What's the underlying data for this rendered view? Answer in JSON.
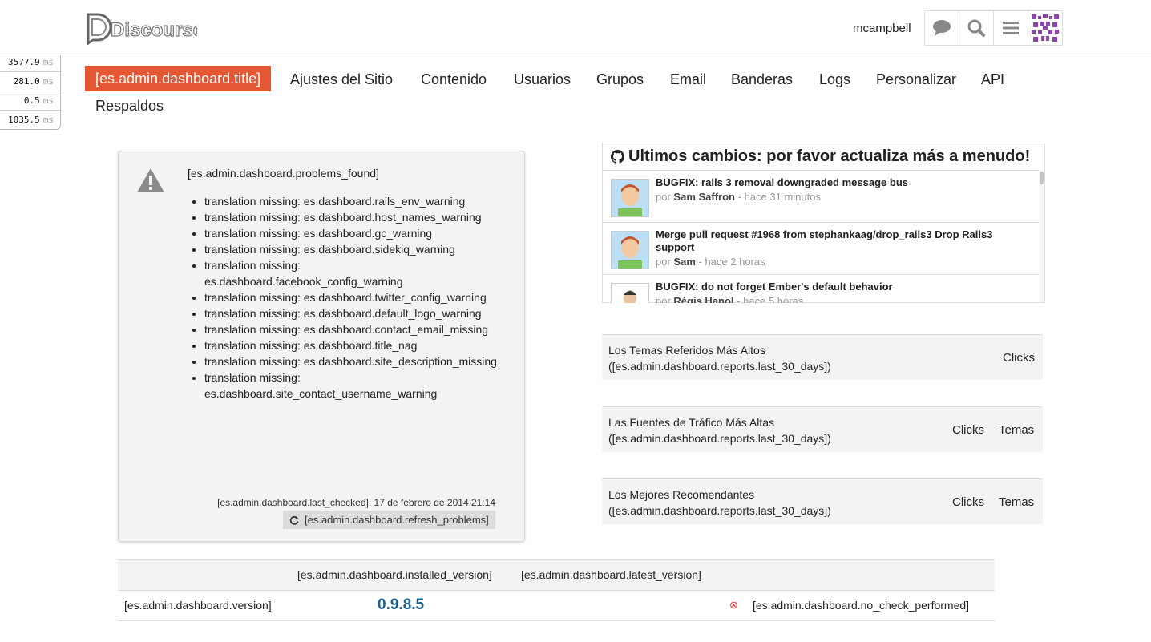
{
  "profiler": [
    {
      "value": "3577.9",
      "unit": "ms"
    },
    {
      "value": "281.0",
      "unit": "ms"
    },
    {
      "value": "0.5",
      "unit": "ms"
    },
    {
      "value": "1035.5",
      "unit": "ms"
    }
  ],
  "header": {
    "logo_text": "Discourse",
    "username": "mcampbell",
    "icons": [
      "chat-bubble-icon",
      "search-icon",
      "hamburger-menu-icon",
      "user-avatar"
    ]
  },
  "nav": {
    "items": [
      {
        "label": "[es.admin.dashboard.title]",
        "active": true
      },
      {
        "label": "Ajustes del Sitio"
      },
      {
        "label": "Contenido"
      },
      {
        "label": "Usuarios"
      },
      {
        "label": "Grupos"
      },
      {
        "label": "Email"
      },
      {
        "label": "Banderas"
      },
      {
        "label": "Logs"
      },
      {
        "label": "Personalizar"
      },
      {
        "label": "API"
      },
      {
        "label": "Respaldos"
      }
    ]
  },
  "problems": {
    "title": "[es.admin.dashboard.problems_found]",
    "items": [
      "translation missing: es.dashboard.rails_env_warning",
      "translation missing: es.dashboard.host_names_warning",
      "translation missing: es.dashboard.gc_warning",
      "translation missing: es.dashboard.sidekiq_warning",
      "translation missing: es.dashboard.facebook_config_warning",
      "translation missing: es.dashboard.twitter_config_warning",
      "translation missing: es.dashboard.default_logo_warning",
      "translation missing: es.dashboard.contact_email_missing",
      "translation missing: es.dashboard.title_nag",
      "translation missing: es.dashboard.site_description_missing",
      "translation missing: es.dashboard.site_contact_username_warning"
    ],
    "last_checked_label": "[es.admin.dashboard.last_checked]: 17 de febrero de 2014 21:14",
    "refresh_label": "[es.admin.dashboard.refresh_problems]"
  },
  "commits": {
    "title": "Ultimos cambios: por favor actualiza más a menudo!",
    "items": [
      {
        "message": "BUGFIX: rails 3 removal downgraded message bus",
        "by": "por",
        "author": "Sam Saffron",
        "time": "- hace 31 minutos"
      },
      {
        "message": "Merge pull request #1968 from stephankaag/drop_rails3 Drop Rails3 support",
        "by": "por",
        "author": "Sam",
        "time": "- hace 2 horas"
      },
      {
        "message": "BUGFIX: do not forget Ember's default behavior",
        "by": "por",
        "author": "Régis Hanol",
        "time": "- hace 5 horas"
      }
    ]
  },
  "reports": [
    {
      "title": "Los Temas Referidos Más Altos",
      "subtitle": "([es.admin.dashboard.reports.last_30_days])",
      "cols": [
        "Clicks"
      ]
    },
    {
      "title": "Las Fuentes de Tráfico Más Altas",
      "subtitle": "([es.admin.dashboard.reports.last_30_days])",
      "cols": [
        "Clicks",
        "Temas"
      ]
    },
    {
      "title": "Los Mejores Recomendantes",
      "subtitle": "([es.admin.dashboard.reports.last_30_days])",
      "cols": [
        "Clicks",
        "Temas"
      ]
    }
  ],
  "version": {
    "installed_header": "[es.admin.dashboard.installed_version]",
    "latest_header": "[es.admin.dashboard.latest_version]",
    "label": "[es.admin.dashboard.version]",
    "installed": "0.9.8.5",
    "status_icon": "⊗",
    "status_text": "[es.admin.dashboard.no_check_performed]"
  },
  "colors": {
    "accent": "#e45735",
    "version_blue": "#1d5f8f"
  }
}
